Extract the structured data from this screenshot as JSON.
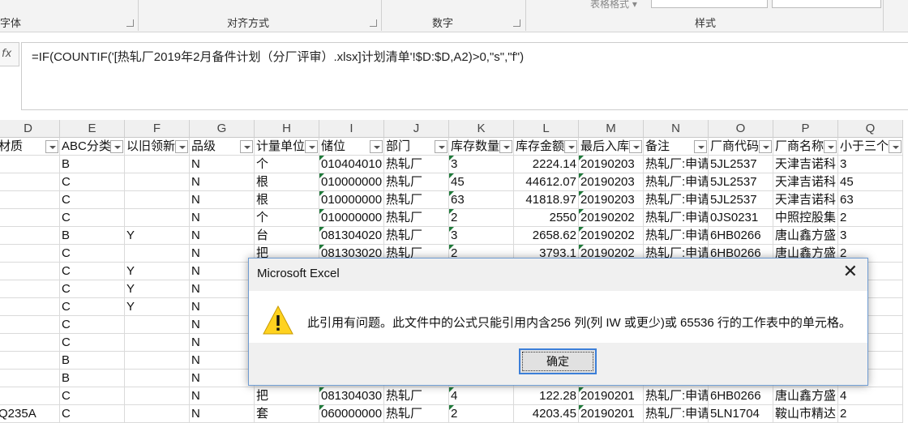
{
  "ribbon": {
    "groups": [
      "字体",
      "对齐方式",
      "数字",
      "样式"
    ],
    "table_format": "表格格式 ▾"
  },
  "formula_bar": {
    "fx": "fx",
    "formula": "=IF(COUNTIF('[热轧厂2019年2月备件计划（分厂评审）.xlsx]计划清单'!$D:$D,A2)>0,\"s\",\"f\")"
  },
  "columns": [
    "D",
    "E",
    "F",
    "G",
    "H",
    "I",
    "J",
    "K",
    "L",
    "M",
    "N",
    "O",
    "P",
    "Q"
  ],
  "headers": [
    "材质",
    "ABC分类",
    "以旧领新",
    "品级",
    "计量单位",
    "储位",
    "部门",
    "库存数量",
    "库存金额",
    "最后入库",
    "备注",
    "厂商代码",
    "厂商名称",
    "小于三个"
  ],
  "rows": [
    [
      "",
      "B",
      "",
      "N",
      "个",
      "010404010",
      "热轧厂",
      "3",
      "2224.14",
      "20190203",
      "热轧厂:申请",
      "5JL2537",
      "天津吉诺科",
      "3"
    ],
    [
      "",
      "C",
      "",
      "N",
      "根",
      "010000000",
      "热轧厂",
      "45",
      "44612.07",
      "20190203",
      "热轧厂:申请",
      "5JL2537",
      "天津吉诺科",
      "45"
    ],
    [
      "",
      "C",
      "",
      "N",
      "根",
      "010000000",
      "热轧厂",
      "63",
      "41818.97",
      "20190203",
      "热轧厂:申请",
      "5JL2537",
      "天津吉诺科",
      "63"
    ],
    [
      "",
      "C",
      "",
      "N",
      "个",
      "010000000",
      "热轧厂",
      "2",
      "2550",
      "20190202",
      "热轧厂:申请",
      "0JS0231",
      "中照控股集",
      "2"
    ],
    [
      "",
      "B",
      "Y",
      "N",
      "台",
      "081304020",
      "热轧厂",
      "3",
      "2658.62",
      "20190202",
      "热轧厂:申请",
      "6HB0266",
      "唐山鑫方盛",
      "3"
    ],
    [
      "",
      "C",
      "",
      "N",
      "把",
      "081303020",
      "热轧厂",
      "2",
      "3793.1",
      "20190202",
      "热轧厂:申请",
      "6HB0266",
      "唐山鑫方盛",
      "2"
    ],
    [
      "",
      "C",
      "Y",
      "N",
      "",
      "",
      "",
      "",
      "",
      "",
      "",
      "",
      "",
      ""
    ],
    [
      "",
      "C",
      "Y",
      "N",
      "",
      "",
      "",
      "",
      "",
      "",
      "",
      "",
      "",
      ""
    ],
    [
      "",
      "C",
      "Y",
      "N",
      "",
      "",
      "",
      "",
      "",
      "",
      "",
      "",
      "",
      ""
    ],
    [
      "",
      "C",
      "",
      "N",
      "",
      "",
      "",
      "",
      "",
      "",
      "",
      "",
      "",
      ""
    ],
    [
      "",
      "C",
      "",
      "N",
      "",
      "",
      "",
      "",
      "",
      "",
      "",
      "",
      "",
      ""
    ],
    [
      "",
      "B",
      "",
      "N",
      "",
      "",
      "",
      "",
      "",
      "",
      "",
      "",
      "",
      ""
    ],
    [
      "",
      "B",
      "",
      "N",
      "",
      "",
      "",
      "",
      "",
      "",
      "",
      "",
      "",
      ""
    ],
    [
      "",
      "C",
      "",
      "N",
      "把",
      "081304030",
      "热轧厂",
      "4",
      "122.28",
      "20190201",
      "热轧厂:申请",
      "6HB0266",
      "唐山鑫方盛",
      "4"
    ],
    [
      "Q235A",
      "C",
      "",
      "N",
      "套",
      "060000000",
      "热轧厂",
      "2",
      "4203.45",
      "20190201",
      "热轧厂:申请",
      "5LN1704",
      "鞍山市精达",
      "2"
    ]
  ],
  "dialog": {
    "title": "Microsoft Excel",
    "message": "此引用有问题。此文件中的公式只能引用内含256 列(列 IW 或更少)或 65536 行的工作表中的单元格。",
    "ok_label": "确定",
    "close_glyph": "✕"
  }
}
